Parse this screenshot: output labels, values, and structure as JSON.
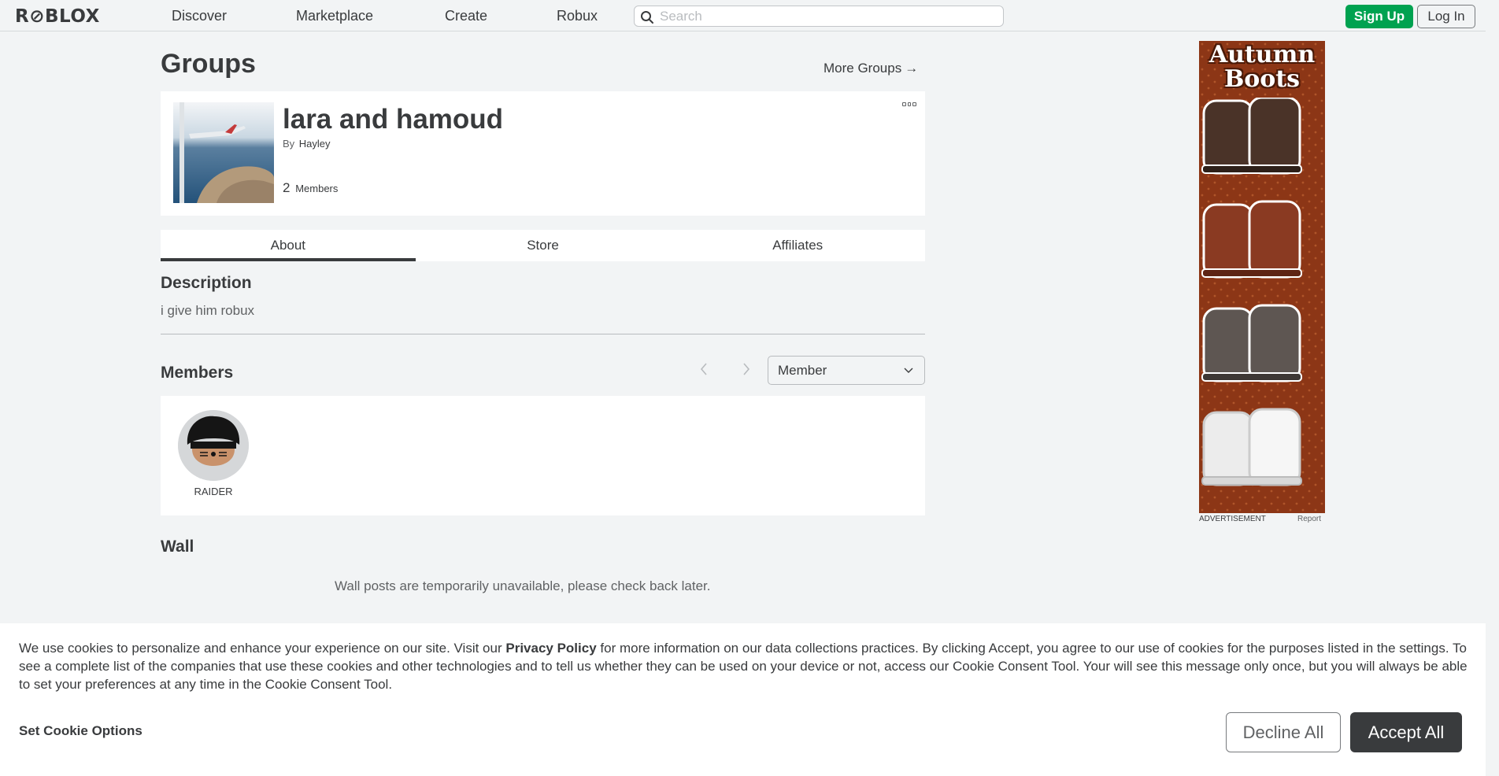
{
  "nav": {
    "logo": "R⊘BLOX",
    "links": [
      "Discover",
      "Marketplace",
      "Create",
      "Robux"
    ],
    "search_placeholder": "Search",
    "signup": "Sign Up",
    "login": "Log In"
  },
  "page": {
    "title": "Groups",
    "more_groups": "More Groups",
    "more_groups_arrow": "→"
  },
  "group": {
    "name": "lara and hamoud",
    "by_label": "By",
    "owner": "Hayley",
    "member_count": "2",
    "member_label": "Members"
  },
  "tabs": [
    "About",
    "Store",
    "Affiliates"
  ],
  "about": {
    "description_heading": "Description",
    "description": "i give him robux",
    "members_heading": "Members",
    "role_selected": "Member",
    "members": [
      {
        "name": "RAIDER"
      }
    ],
    "wall_heading": "Wall",
    "wall_message": "Wall posts are temporarily unavailable, please check back later."
  },
  "ad": {
    "title_line1": "Autumn",
    "title_line2": "Boots",
    "label": "ADVERTISEMENT",
    "report": "Report",
    "boot_colors": [
      "#4a3328",
      "#8a3a22",
      "#5e5652",
      "#ececec"
    ]
  },
  "cookie": {
    "text_before": "We use cookies to personalize and enhance your experience on our site. Visit our ",
    "privacy_link": "Privacy Policy",
    "text_after": " for more information on our data collections practices. By clicking Accept, you agree to our use of cookies for the purposes listed in the settings. To see a complete list of the companies that use these cookies and other technologies and to tell us whether they can be used on your device or not, access our Cookie Consent Tool. Your will see this message only once, but you will always be able to set your preferences at any time in the Cookie Consent Tool.",
    "set_options": "Set Cookie Options",
    "decline": "Decline All",
    "accept": "Accept All"
  }
}
